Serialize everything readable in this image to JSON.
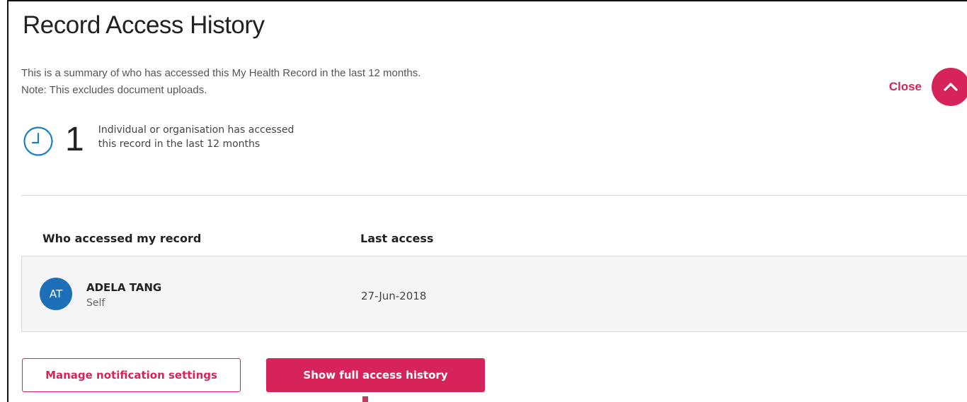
{
  "panel": {
    "title": "Record Access History",
    "description_line1": "This is a summary of who has accessed this My Health Record in the last 12 months.",
    "description_line2": "Note: This excludes document uploads.",
    "close_label": "Close"
  },
  "summary": {
    "count": "1",
    "text_line1": "Individual or organisation has accessed",
    "text_line2": "this record in the last 12 months",
    "icon": "clock-icon"
  },
  "table": {
    "headers": [
      "Who accessed my record",
      "Last access"
    ],
    "rows": [
      {
        "initials": "AT",
        "name": "ADELA TANG",
        "role": "Self",
        "last_access": "27-Jun-2018"
      }
    ]
  },
  "actions": {
    "manage_label": "Manage notification settings",
    "show_history_label": "Show full access history"
  },
  "colors": {
    "accent": "#d6245b",
    "avatar": "#1d6fb8",
    "clock": "#1d7fc4"
  }
}
